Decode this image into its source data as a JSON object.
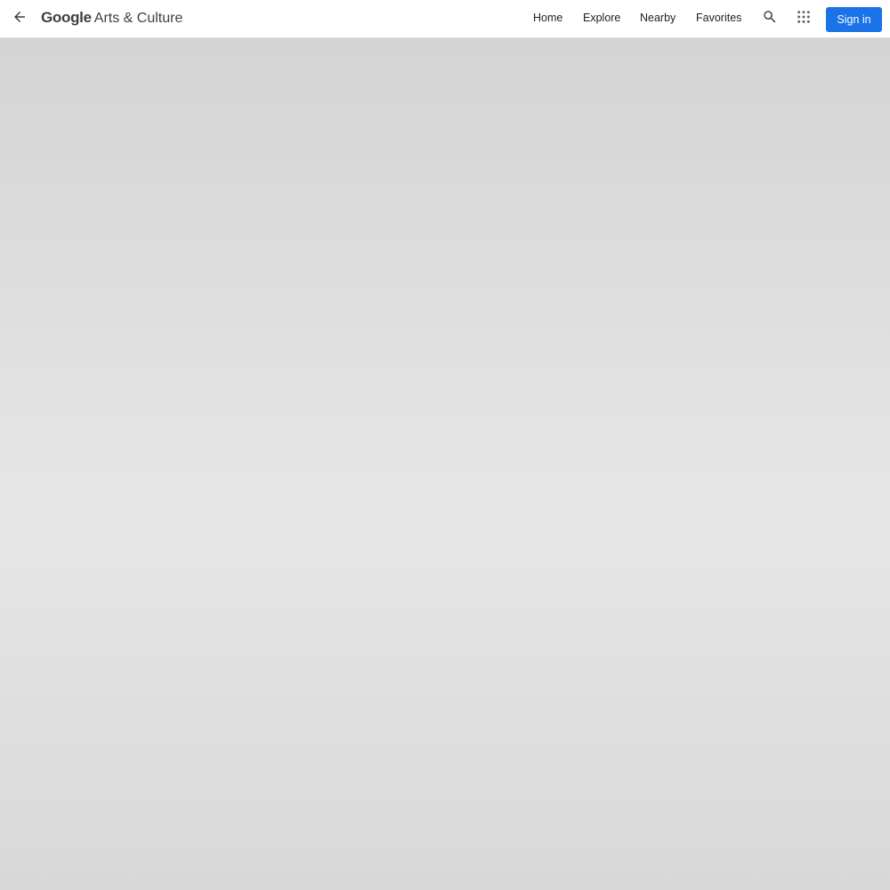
{
  "header": {
    "logo_google": "Google",
    "logo_rest": "Arts & Culture",
    "nav": {
      "home": "Home",
      "explore": "Explore",
      "nearby": "Nearby",
      "favorites": "Favorites"
    },
    "sign_in_label": "Sign in",
    "icons": {
      "back": "arrow-back-icon",
      "search": "search-icon",
      "apps": "apps-grid-icon"
    },
    "colors": {
      "accent": "#1a73e8",
      "text": "#202124"
    }
  }
}
